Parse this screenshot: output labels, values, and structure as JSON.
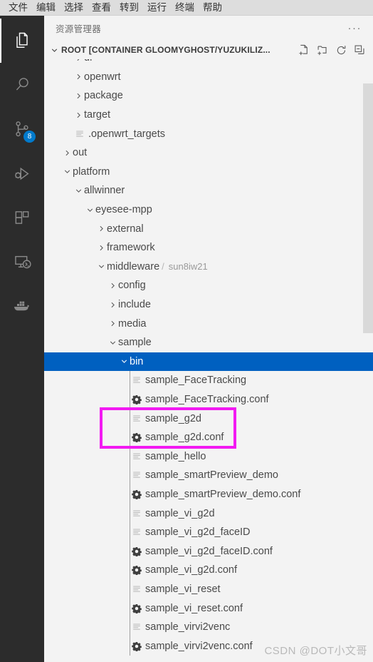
{
  "menubar": {
    "items": [
      {
        "label": "文件"
      },
      {
        "label": "编辑"
      },
      {
        "label": "选择"
      },
      {
        "label": "查看"
      },
      {
        "label": "转到"
      },
      {
        "label": "运行"
      },
      {
        "label": "终端"
      },
      {
        "label": "帮助"
      }
    ]
  },
  "activitybar": {
    "items": [
      {
        "name": "explorer",
        "icon": "files-icon",
        "active": true,
        "badge": ""
      },
      {
        "name": "search",
        "icon": "search-icon",
        "active": false,
        "badge": ""
      },
      {
        "name": "source-control",
        "icon": "source-control-icon",
        "active": false,
        "badge": "8"
      },
      {
        "name": "run-debug",
        "icon": "run-and-debug-icon",
        "active": false,
        "badge": ""
      },
      {
        "name": "extensions",
        "icon": "extensions-icon",
        "active": false,
        "badge": ""
      },
      {
        "name": "remote-explorer",
        "icon": "remote-explorer-icon",
        "active": false,
        "badge": ""
      },
      {
        "name": "docker",
        "icon": "docker-whale-icon",
        "active": false,
        "badge": ""
      }
    ]
  },
  "sidebar": {
    "title": "资源管理器",
    "more_actions": "···",
    "root": {
      "label": "ROOT [CONTAINER GLOOMYGHOST/YUZUKILIZ...",
      "expanded": true,
      "actions": [
        {
          "name": "new-file-icon",
          "tooltip": "新建文件"
        },
        {
          "name": "new-folder-icon",
          "tooltip": "新建文件夹"
        },
        {
          "name": "refresh-icon",
          "tooltip": "刷新资源管理器"
        },
        {
          "name": "collapse-all-icon",
          "tooltip": "在资源管理器中折叠文件夹"
        }
      ]
    }
  },
  "tree": {
    "rows": [
      {
        "label": "dl",
        "kind": "folder",
        "expanded": false,
        "depth": 2,
        "clipped": true
      },
      {
        "label": "openwrt",
        "kind": "folder",
        "expanded": false,
        "depth": 2
      },
      {
        "label": "package",
        "kind": "folder",
        "expanded": false,
        "depth": 2
      },
      {
        "label": "target",
        "kind": "folder",
        "expanded": false,
        "depth": 2
      },
      {
        "label": ".openwrt_targets",
        "kind": "file",
        "depth": 2
      },
      {
        "label": "out",
        "kind": "folder",
        "expanded": false,
        "depth": 1
      },
      {
        "label": "platform",
        "kind": "folder",
        "expanded": true,
        "depth": 1
      },
      {
        "label": "allwinner",
        "kind": "folder",
        "expanded": true,
        "depth": 2
      },
      {
        "label": "eyesee-mpp",
        "kind": "folder",
        "expanded": true,
        "depth": 3
      },
      {
        "label": "external",
        "kind": "folder",
        "expanded": false,
        "depth": 4
      },
      {
        "label": "framework",
        "kind": "folder",
        "expanded": false,
        "depth": 4
      },
      {
        "label": "middleware",
        "sub": "sun8iw21",
        "kind": "folder",
        "expanded": true,
        "depth": 4
      },
      {
        "label": "config",
        "kind": "folder",
        "expanded": false,
        "depth": 5
      },
      {
        "label": "include",
        "kind": "folder",
        "expanded": false,
        "depth": 5
      },
      {
        "label": "media",
        "kind": "folder",
        "expanded": false,
        "depth": 5
      },
      {
        "label": "sample",
        "kind": "folder",
        "expanded": true,
        "depth": 5
      },
      {
        "label": "bin",
        "kind": "folder",
        "expanded": true,
        "depth": 6,
        "selected": true
      },
      {
        "label": "sample_FaceTracking",
        "kind": "file",
        "depth": 7
      },
      {
        "label": "sample_FaceTracking.conf",
        "kind": "conf",
        "depth": 7
      },
      {
        "label": "sample_g2d",
        "kind": "file",
        "depth": 7,
        "annotated": true
      },
      {
        "label": "sample_g2d.conf",
        "kind": "conf",
        "depth": 7,
        "annotated": true
      },
      {
        "label": "sample_hello",
        "kind": "file",
        "depth": 7
      },
      {
        "label": "sample_smartPreview_demo",
        "kind": "file",
        "depth": 7
      },
      {
        "label": "sample_smartPreview_demo.conf",
        "kind": "conf",
        "depth": 7
      },
      {
        "label": "sample_vi_g2d",
        "kind": "file",
        "depth": 7
      },
      {
        "label": "sample_vi_g2d_faceID",
        "kind": "file",
        "depth": 7
      },
      {
        "label": "sample_vi_g2d_faceID.conf",
        "kind": "conf",
        "depth": 7
      },
      {
        "label": "sample_vi_g2d.conf",
        "kind": "conf",
        "depth": 7
      },
      {
        "label": "sample_vi_reset",
        "kind": "file",
        "depth": 7
      },
      {
        "label": "sample_vi_reset.conf",
        "kind": "conf",
        "depth": 7
      },
      {
        "label": "sample_virvi2venc",
        "kind": "file",
        "depth": 7
      },
      {
        "label": "sample_virvi2venc.conf",
        "kind": "conf",
        "depth": 7
      }
    ]
  },
  "annotation": {
    "color": "#f21af2",
    "targets": [
      "sample_g2d",
      "sample_g2d.conf"
    ]
  },
  "watermark": {
    "text": "CSDN @DOT小文哥"
  },
  "colors": {
    "selection": "#0060c0",
    "badge": "#007acc",
    "sidebar_bg": "#f3f3f3",
    "activitybar_bg": "#2c2c2c",
    "menubar_bg": "#dddddd",
    "annotation": "#f21af2"
  }
}
